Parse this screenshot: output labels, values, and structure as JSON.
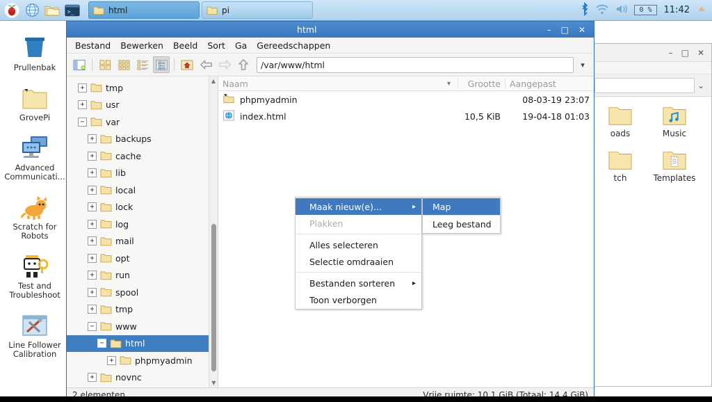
{
  "taskbar": {
    "launcher": [
      {
        "name": "raspberry-menu-icon",
        "label": "Menu"
      },
      {
        "name": "web-browser-icon",
        "label": "Web Browser"
      },
      {
        "name": "file-manager-icon",
        "label": "File Manager"
      },
      {
        "name": "terminal-icon",
        "label": "Terminal"
      }
    ],
    "windows": [
      {
        "label": "html",
        "active": true
      },
      {
        "label": "pi",
        "active": false
      }
    ],
    "tray": {
      "bluetooth_icon": "bluetooth-icon",
      "wifi_icon": "wifi-icon",
      "volume_icon": "volume-icon",
      "cpu_label": "0 %",
      "clock": "11:42",
      "eject_icon": "eject-icon"
    }
  },
  "desktop": {
    "icons": [
      {
        "label": "Prullenbak",
        "icon": "trash-icon"
      },
      {
        "label": "GrovePi",
        "icon": "folder-shortcut-icon"
      },
      {
        "label": "Advanced Communicati...",
        "icon": "computers-icon"
      },
      {
        "label": "Scratch for Robots",
        "icon": "scratch-cat-icon"
      },
      {
        "label": "Test and Troubleshoot",
        "icon": "robot-icon"
      },
      {
        "label": "Line Follower Calibration",
        "icon": "tools-icon"
      }
    ]
  },
  "background_window": {
    "path_value": "",
    "items": [
      {
        "label": "oads",
        "icon": "folder-icon"
      },
      {
        "label": "Music",
        "icon": "music-folder-icon"
      },
      {
        "label": "tch",
        "icon": "folder-icon"
      },
      {
        "label": "Templates",
        "icon": "templates-folder-icon"
      }
    ],
    "window_buttons": {
      "minimize": "–",
      "maximize": "□",
      "close": "✕"
    }
  },
  "file_manager": {
    "title": "html",
    "window_buttons": {
      "minimize": "–",
      "maximize": "□",
      "close": "✕"
    },
    "menus": [
      "Bestand",
      "Bewerken",
      "Beeld",
      "Sort",
      "Ga",
      "Gereedschappen"
    ],
    "toolbar": [
      {
        "name": "new-tab-icon",
        "pressed": false
      },
      {
        "name": "icon-view-icon",
        "pressed": false
      },
      {
        "name": "compact-view-icon",
        "pressed": false
      },
      {
        "name": "thumbnail-view-icon",
        "pressed": false
      },
      {
        "name": "detailed-list-view-icon",
        "pressed": true
      },
      {
        "name": "home-icon",
        "pressed": false
      },
      {
        "name": "back-arrow-icon",
        "pressed": false
      },
      {
        "name": "forward-arrow-icon",
        "pressed": false
      },
      {
        "name": "up-arrow-icon",
        "pressed": false
      }
    ],
    "path_value": "/var/www/html",
    "tree": [
      {
        "label": "tmp",
        "depth": 0,
        "expander": "+",
        "selected": false
      },
      {
        "label": "usr",
        "depth": 0,
        "expander": "+",
        "selected": false
      },
      {
        "label": "var",
        "depth": 0,
        "expander": "−",
        "selected": false
      },
      {
        "label": "backups",
        "depth": 1,
        "expander": "+",
        "selected": false
      },
      {
        "label": "cache",
        "depth": 1,
        "expander": "+",
        "selected": false
      },
      {
        "label": "lib",
        "depth": 1,
        "expander": "+",
        "selected": false
      },
      {
        "label": "local",
        "depth": 1,
        "expander": "+",
        "selected": false
      },
      {
        "label": "lock",
        "depth": 1,
        "expander": "+",
        "selected": false
      },
      {
        "label": "log",
        "depth": 1,
        "expander": "+",
        "selected": false
      },
      {
        "label": "mail",
        "depth": 1,
        "expander": "+",
        "selected": false
      },
      {
        "label": "opt",
        "depth": 1,
        "expander": "+",
        "selected": false
      },
      {
        "label": "run",
        "depth": 1,
        "expander": "+",
        "selected": false
      },
      {
        "label": "spool",
        "depth": 1,
        "expander": "+",
        "selected": false
      },
      {
        "label": "tmp",
        "depth": 1,
        "expander": "+",
        "selected": false
      },
      {
        "label": "www",
        "depth": 1,
        "expander": "−",
        "selected": false
      },
      {
        "label": "html",
        "depth": 2,
        "expander": "−",
        "selected": true
      },
      {
        "label": "phpmyadmin",
        "depth": 3,
        "expander": "+",
        "selected": false
      },
      {
        "label": "novnc",
        "depth": 2,
        "expander": "+",
        "selected": false
      }
    ],
    "columns": {
      "name": "Naam",
      "size": "Grootte",
      "modified": "Aangepast"
    },
    "files": [
      {
        "name": "phpmyadmin",
        "size": "",
        "modified": "08-03-19 23:07",
        "icon": "folder-link-icon"
      },
      {
        "name": "index.html",
        "size": "10,5 KiB",
        "modified": "19-04-18 01:03",
        "icon": "html-file-icon"
      }
    ],
    "status": {
      "left": "2 elementen",
      "right": "Vrije ruimte: 10,1 GiB (Totaal: 14,4 GiB)"
    }
  },
  "context_menu": {
    "items": [
      {
        "label": "Maak nieuw(e)...",
        "highlighted": true,
        "disabled": false,
        "submenu": true
      },
      {
        "label": "Plakken",
        "highlighted": false,
        "disabled": true,
        "submenu": false
      },
      {
        "label": "Alles selecteren",
        "highlighted": false,
        "disabled": false,
        "submenu": false
      },
      {
        "label": "Selectie omdraaien",
        "highlighted": false,
        "disabled": false,
        "submenu": false
      },
      {
        "label": "Bestanden sorteren",
        "highlighted": false,
        "disabled": false,
        "submenu": true
      },
      {
        "label": "Toon verborgen",
        "highlighted": false,
        "disabled": false,
        "submenu": false
      }
    ],
    "submenu": {
      "items": [
        {
          "label": "Map",
          "highlighted": true
        },
        {
          "label": "Leeg bestand",
          "highlighted": false
        }
      ]
    }
  },
  "colors": {
    "titlebar_blue": "#3a78bf",
    "selection_blue": "#3f7fc1",
    "menu_highlight": "#4079bd",
    "taskbar_blue": "#aed2ee",
    "folder_yellow": "#f2dfa0"
  }
}
